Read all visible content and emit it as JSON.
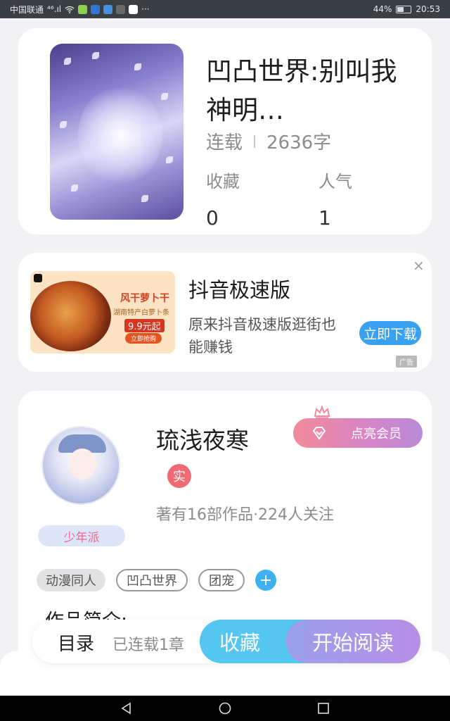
{
  "status_bar": {
    "carrier": "中国联通",
    "signal": "⁴⁶.ıl",
    "battery": "44%",
    "time": "20:53"
  },
  "book": {
    "title": "凹凸世界:别叫我神明…",
    "status": "连载",
    "word_count": "2636字",
    "favorites_label": "收藏",
    "favorites_value": "0",
    "popularity_label": "人气",
    "popularity_value": "1"
  },
  "ad": {
    "title": "抖音极速版",
    "description": "原来抖音极速版逛街也能赚钱",
    "cta": "立即下载",
    "close": "×",
    "tag": "广告",
    "image_heading": "风干萝卜干",
    "image_sub": "湖南特产白萝卜条",
    "image_price": "9.9元起",
    "image_buy": "立即抢购"
  },
  "author": {
    "name": "琉浅夜寒",
    "verified_badge": "实",
    "stats": "著有16部作品·224人关注",
    "level": "少年派",
    "vip_button": "点亮会员"
  },
  "tags": [
    {
      "label": "动漫同人",
      "style": "filled"
    },
    {
      "label": "凹凸世界",
      "style": "outline"
    },
    {
      "label": "团宠",
      "style": "outline"
    }
  ],
  "tag_add": "+",
  "intro_title": "作品简介:",
  "bottom_bar": {
    "toc": "目录",
    "chapters": "已连载1章",
    "favorite": "收藏",
    "read": "开始阅读"
  },
  "colors": {
    "accent_blue": "#3aa0f0",
    "favorite_btn": "#54c6ef",
    "read_btn_start": "#9aa0ea",
    "read_btn_end": "#b78ee6",
    "vip_start": "#f28a9a",
    "vip_end": "#b88ad8"
  },
  "icons": [
    "wifi-icon",
    "close-icon",
    "diamond-icon",
    "crown-icon",
    "plus-icon",
    "back-icon",
    "home-icon",
    "recents-icon"
  ]
}
